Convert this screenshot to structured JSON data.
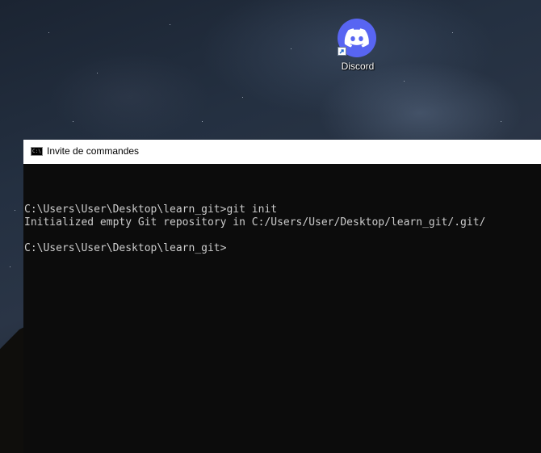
{
  "desktop": {
    "shortcut": {
      "label": "Discord",
      "icon": "discord-icon",
      "brand_color": "#5865f2"
    }
  },
  "cmd_window": {
    "title": "Invite de commandes",
    "icon": "command-prompt-icon",
    "icon_text": "C:\\.",
    "background": "#0c0c0c",
    "text_color": "#cccccc",
    "lines": [
      "",
      "C:\\Users\\User\\Desktop\\learn_git>git init",
      "Initialized empty Git repository in C:/Users/User/Desktop/learn_git/.git/",
      "",
      "C:\\Users\\User\\Desktop\\learn_git>"
    ]
  }
}
